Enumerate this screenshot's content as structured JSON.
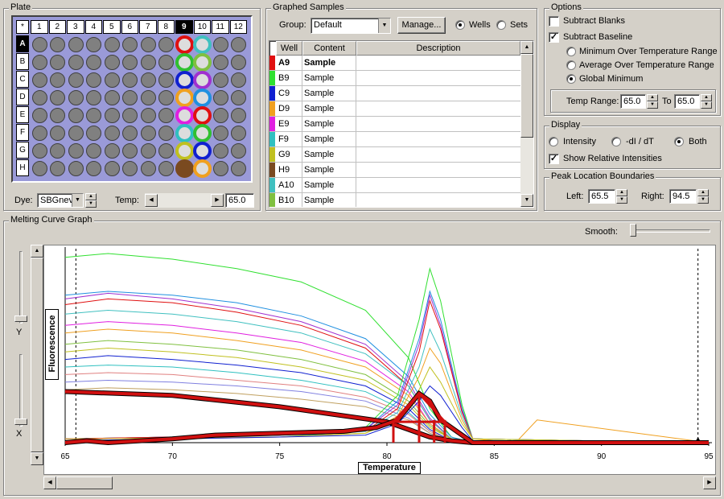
{
  "plate": {
    "title": "Plate",
    "corner": "*",
    "cols": [
      "1",
      "2",
      "3",
      "4",
      "5",
      "6",
      "7",
      "8",
      "9",
      "10",
      "11",
      "12"
    ],
    "rows": [
      "A",
      "B",
      "C",
      "D",
      "E",
      "F",
      "G",
      "H"
    ],
    "selected_col": "9",
    "ring_col9": [
      "#e01010",
      "#30c030",
      "#1020d0",
      "#f0a020",
      "#e020e0",
      "#30c0c0",
      "#c0c020",
      "#7a4a20"
    ],
    "ring_col10": [
      "#40c0c0",
      "#80c040",
      "#a030d0",
      "#2090e0",
      "#e01010",
      "#30c030",
      "#1020d0",
      "#f0a020"
    ],
    "dye_label": "Dye:",
    "dye_value": "SBGnev",
    "temp_label": "Temp:",
    "temp_value": "65.0"
  },
  "samples": {
    "title": "Graphed Samples",
    "group_label": "Group:",
    "group_value": "Default",
    "manage_label": "Manage...",
    "wells_label": "Wells",
    "sets_label": "Sets",
    "mode": "Wells",
    "columns": [
      "Well",
      "Content",
      "Description"
    ],
    "rows": [
      {
        "color": "#e01010",
        "well": "A9",
        "content": "Sample",
        "bold": true
      },
      {
        "color": "#30e030",
        "well": "B9",
        "content": "Sample"
      },
      {
        "color": "#1020d0",
        "well": "C9",
        "content": "Sample"
      },
      {
        "color": "#f0a020",
        "well": "D9",
        "content": "Sample"
      },
      {
        "color": "#e020e0",
        "well": "E9",
        "content": "Sample"
      },
      {
        "color": "#30c0c0",
        "well": "F9",
        "content": "Sample"
      },
      {
        "color": "#c0c020",
        "well": "G9",
        "content": "Sample"
      },
      {
        "color": "#7a4a20",
        "well": "H9",
        "content": "Sample"
      },
      {
        "color": "#40c0c0",
        "well": "A10",
        "content": "Sample"
      },
      {
        "color": "#80c040",
        "well": "B10",
        "content": "Sample"
      }
    ]
  },
  "options": {
    "title": "Options",
    "subtract_blanks": "Subtract Blanks",
    "subtract_baseline": "Subtract Baseline",
    "min_range": "Minimum Over Temperature Range",
    "avg_range": "Average Over Temperature Range",
    "global_min": "Global Minimum",
    "temp_range_label": "Temp Range:",
    "temp_range_from": "65.0",
    "to_label": "To",
    "temp_range_to": "65.0"
  },
  "display": {
    "title": "Display",
    "intensity": "Intensity",
    "derivative": "-dI / dT",
    "both": "Both",
    "show_relative": "Show Relative Intensities"
  },
  "peak": {
    "title": "Peak Location Boundaries",
    "left_label": "Left:",
    "left_value": "65.5",
    "right_label": "Right:",
    "right_value": "94.5"
  },
  "graph": {
    "title": "Melting Curve Graph",
    "smooth_label": "Smooth:",
    "y_label": "Fluorescence",
    "x_label": "Temperature",
    "y_axis_label": "Y",
    "x_axis_label": "X",
    "x_ticks": [
      "65",
      "70",
      "75",
      "80",
      "85",
      "90",
      "95"
    ]
  },
  "chart_data": {
    "type": "line",
    "xlabel": "Temperature",
    "ylabel": "Fluorescence",
    "xlim": [
      65,
      95
    ],
    "ylim": [
      0,
      1
    ],
    "intensity_series": [
      {
        "color": "#30e030",
        "x": [
          65,
          67,
          70,
          73,
          76,
          79,
          81,
          82,
          83,
          84
        ],
        "y": [
          0.98,
          1.0,
          0.97,
          0.92,
          0.85,
          0.7,
          0.45,
          0.18,
          0.03,
          0.0
        ]
      },
      {
        "color": "#2090e0",
        "x": [
          65,
          67,
          70,
          73,
          76,
          79,
          81,
          82,
          83,
          84
        ],
        "y": [
          0.78,
          0.8,
          0.78,
          0.74,
          0.67,
          0.55,
          0.35,
          0.15,
          0.03,
          0.0
        ]
      },
      {
        "color": "#a030d0",
        "x": [
          65,
          67,
          70,
          73,
          76,
          79,
          81,
          82,
          83,
          84
        ],
        "y": [
          0.76,
          0.79,
          0.76,
          0.71,
          0.64,
          0.52,
          0.32,
          0.13,
          0.02,
          0.0
        ]
      },
      {
        "color": "#e01010",
        "x": [
          65,
          67,
          70,
          73,
          76,
          79,
          81,
          82,
          83,
          84
        ],
        "y": [
          0.73,
          0.76,
          0.74,
          0.69,
          0.62,
          0.5,
          0.3,
          0.12,
          0.02,
          0.0
        ]
      },
      {
        "color": "#40c0c0",
        "x": [
          65,
          67,
          70,
          73,
          76,
          79,
          81,
          82,
          83,
          84
        ],
        "y": [
          0.68,
          0.7,
          0.68,
          0.64,
          0.58,
          0.47,
          0.3,
          0.12,
          0.02,
          0.0
        ]
      },
      {
        "color": "#e020e0",
        "x": [
          65,
          67,
          70,
          73,
          76,
          79,
          81,
          82,
          83,
          84
        ],
        "y": [
          0.62,
          0.64,
          0.62,
          0.58,
          0.53,
          0.43,
          0.27,
          0.1,
          0.02,
          0.0
        ]
      },
      {
        "color": "#f0a020",
        "x": [
          65,
          67,
          70,
          73,
          76,
          79,
          81,
          82,
          83,
          84
        ],
        "y": [
          0.58,
          0.6,
          0.58,
          0.54,
          0.49,
          0.4,
          0.25,
          0.1,
          0.02,
          0.0
        ]
      },
      {
        "color": "#80c040",
        "x": [
          65,
          67,
          70,
          73,
          76,
          79,
          81,
          82,
          83,
          84
        ],
        "y": [
          0.52,
          0.54,
          0.52,
          0.49,
          0.44,
          0.36,
          0.22,
          0.09,
          0.02,
          0.0
        ]
      },
      {
        "color": "#c0c020",
        "x": [
          65,
          67,
          70,
          73,
          76,
          79,
          81,
          82,
          83,
          84
        ],
        "y": [
          0.48,
          0.5,
          0.48,
          0.45,
          0.4,
          0.33,
          0.2,
          0.08,
          0.02,
          0.0
        ]
      },
      {
        "color": "#1020d0",
        "x": [
          65,
          67,
          70,
          73,
          76,
          79,
          81,
          82,
          83,
          84
        ],
        "y": [
          0.44,
          0.46,
          0.44,
          0.41,
          0.37,
          0.3,
          0.18,
          0.07,
          0.01,
          0.0
        ]
      },
      {
        "color": "#30c0c0",
        "x": [
          65,
          67,
          70,
          73,
          76,
          79,
          81,
          82,
          83,
          84
        ],
        "y": [
          0.4,
          0.41,
          0.4,
          0.37,
          0.33,
          0.27,
          0.16,
          0.06,
          0.01,
          0.0
        ]
      },
      {
        "color": "#e08080",
        "x": [
          65,
          67,
          70,
          73,
          76,
          79,
          81,
          82,
          83,
          84
        ],
        "y": [
          0.36,
          0.37,
          0.36,
          0.33,
          0.3,
          0.24,
          0.15,
          0.06,
          0.01,
          0.0
        ]
      },
      {
        "color": "#8080e0",
        "x": [
          65,
          67,
          70,
          73,
          76,
          79,
          81,
          82,
          83,
          84
        ],
        "y": [
          0.32,
          0.33,
          0.32,
          0.3,
          0.27,
          0.22,
          0.13,
          0.05,
          0.01,
          0.0
        ]
      },
      {
        "color": "#c0a060",
        "x": [
          65,
          67,
          70,
          73,
          76,
          79,
          81,
          82,
          83,
          84
        ],
        "y": [
          0.28,
          0.29,
          0.28,
          0.26,
          0.23,
          0.19,
          0.12,
          0.05,
          0.01,
          0.0
        ]
      }
    ],
    "peak_series": [
      {
        "color": "#30e030",
        "x": [
          65,
          75,
          79,
          80.5,
          81.5,
          82,
          82.5,
          83.5,
          84,
          95
        ],
        "y": [
          0.02,
          0.04,
          0.08,
          0.25,
          0.65,
          0.92,
          0.75,
          0.2,
          0.02,
          0.0
        ]
      },
      {
        "color": "#2090e0",
        "x": [
          65,
          75,
          79,
          80.5,
          81.5,
          82,
          82.5,
          83.5,
          84,
          95
        ],
        "y": [
          0.02,
          0.04,
          0.07,
          0.22,
          0.55,
          0.8,
          0.65,
          0.18,
          0.02,
          0.0
        ]
      },
      {
        "color": "#a030d0",
        "x": [
          65,
          75,
          79,
          80.5,
          81.5,
          82,
          82.5,
          83.5,
          84,
          95
        ],
        "y": [
          0.02,
          0.04,
          0.07,
          0.2,
          0.52,
          0.78,
          0.62,
          0.17,
          0.02,
          0.0
        ]
      },
      {
        "color": "#e01010",
        "x": [
          65,
          75,
          79,
          80.5,
          81.5,
          82,
          82.5,
          83.5,
          84,
          95
        ],
        "y": [
          0.02,
          0.04,
          0.06,
          0.18,
          0.48,
          0.75,
          0.6,
          0.16,
          0.02,
          0.0
        ]
      },
      {
        "color": "#40c0c0",
        "x": [
          65,
          75,
          79,
          80.5,
          81.5,
          82,
          82.5,
          83.5,
          84,
          95
        ],
        "y": [
          0.02,
          0.03,
          0.06,
          0.16,
          0.4,
          0.6,
          0.48,
          0.14,
          0.02,
          0.0
        ]
      },
      {
        "color": "#f0a020",
        "x": [
          65,
          75,
          79,
          80.5,
          81.5,
          82,
          82.5,
          83.5,
          84,
          86,
          87,
          95
        ],
        "y": [
          0.02,
          0.03,
          0.05,
          0.14,
          0.35,
          0.5,
          0.42,
          0.12,
          0.02,
          0.0,
          0.12,
          0.0
        ]
      },
      {
        "color": "#c0c020",
        "x": [
          65,
          75,
          79,
          80.5,
          81.5,
          82,
          82.5,
          83.5,
          84,
          95
        ],
        "y": [
          0.01,
          0.03,
          0.05,
          0.12,
          0.28,
          0.4,
          0.32,
          0.1,
          0.02,
          0.0
        ]
      },
      {
        "color": "#1020d0",
        "x": [
          65,
          75,
          79,
          80.5,
          81.5,
          82,
          82.5,
          83.5,
          84,
          95
        ],
        "y": [
          0.01,
          0.03,
          0.04,
          0.1,
          0.22,
          0.3,
          0.25,
          0.08,
          0.01,
          0.0
        ]
      }
    ],
    "selected_intensity": {
      "color": "#d01010",
      "x": [
        65,
        70,
        75,
        80,
        81,
        82,
        83,
        84
      ],
      "y": [
        0.27,
        0.25,
        0.19,
        0.11,
        0.07,
        0.03,
        0.01,
        0.0
      ]
    },
    "selected_peak": {
      "color": "#d01010",
      "x": [
        65,
        66,
        67,
        70,
        72,
        75,
        78,
        79.5,
        80.5,
        81.5,
        82,
        82.5,
        83.5,
        84,
        95
      ],
      "y": [
        0.0,
        0.01,
        0.0,
        0.02,
        0.04,
        0.05,
        0.06,
        0.08,
        0.12,
        0.26,
        0.22,
        0.12,
        0.04,
        0.0,
        0.0
      ]
    },
    "boundaries": {
      "left": 65.5,
      "right": 94.5
    }
  }
}
